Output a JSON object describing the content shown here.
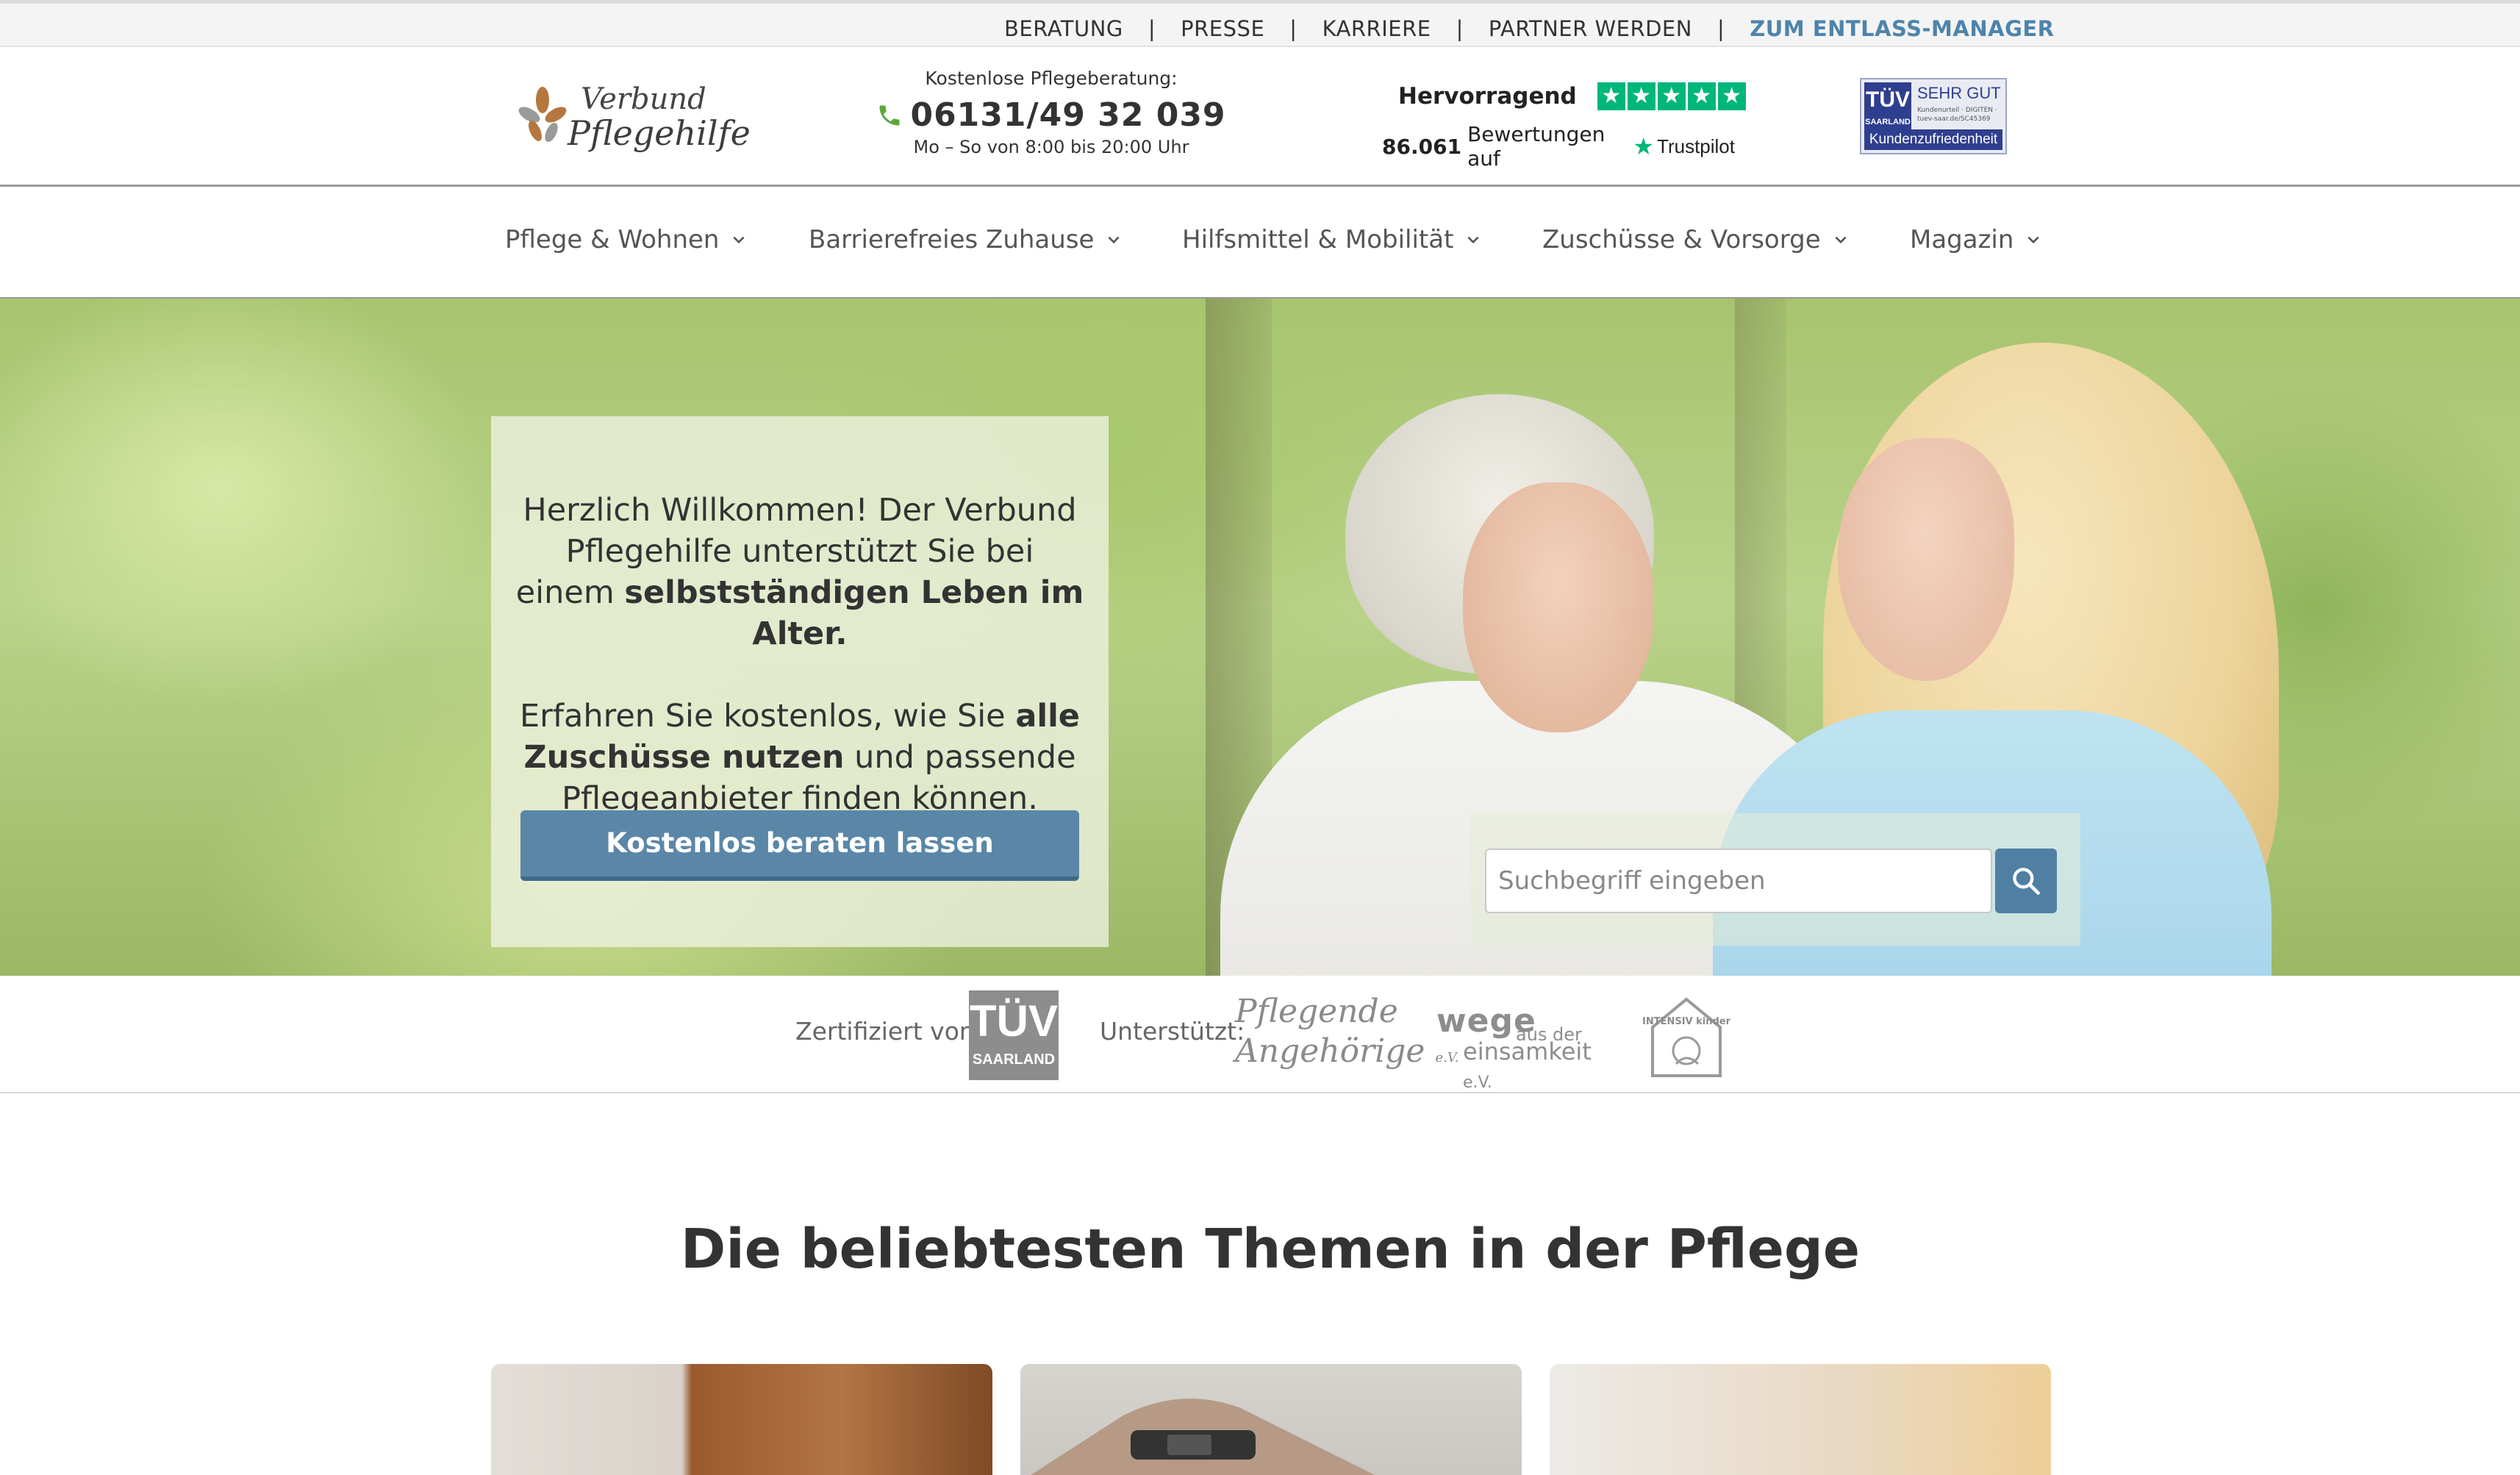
{
  "topbar": {
    "links": [
      "BERATUNG",
      "PRESSE",
      "KARRIERE",
      "PARTNER WERDEN"
    ],
    "separator": "|",
    "accent_link": "ZUM ENTLASS-MANAGER"
  },
  "header": {
    "logo": {
      "line1": "Verbund",
      "line2": "Pflegehilfe"
    },
    "phone": {
      "caption": "Kostenlose Pflegeberatung:",
      "number": "06131/49 32 039",
      "hours": "Mo – So von 8:00 bis 20:00 Uhr"
    },
    "trustpilot": {
      "rating_label": "Hervorragend",
      "stars": 5,
      "reviews_count": "86.061",
      "reviews_text": "Bewertungen auf",
      "brand": "Trustpilot"
    },
    "tuv_badge": {
      "logo_top": "TÜV",
      "logo_bottom": "SAARLAND",
      "grade": "SEHR GUT",
      "fine_print": "Kundenurteil · DIGITEN · tuev-saar.de/SC45369",
      "label": "Kundenzufriedenheit"
    }
  },
  "nav": {
    "items": [
      {
        "label": "Pflege & Wohnen"
      },
      {
        "label": "Barrierefreies Zuhause"
      },
      {
        "label": "Hilfsmittel & Mobilität"
      },
      {
        "label": "Zuschüsse & Vorsorge"
      },
      {
        "label": "Magazin"
      }
    ]
  },
  "hero": {
    "welcome": {
      "p1_a": "Herzlich Willkommen! Der Verbund Pflegehilfe unterstützt Sie bei einem ",
      "p1_b": "selbstständigen Leben im Alter.",
      "p2_a": "Erfahren Sie kostenlos, wie Sie ",
      "p2_b": "alle Zuschüsse nutzen",
      "p2_c": " und passende Pflegeanbieter finden können."
    },
    "cta_label": "Kostenlos beraten lassen",
    "search": {
      "placeholder": "Suchbegriff eingeben"
    }
  },
  "trust": {
    "certified_label": "Zertifiziert von:",
    "tuv_big": "TÜV",
    "tuv_small": "SAARLAND",
    "supported_label": "Unterstützt:",
    "partner1_line1": "Pflegende",
    "partner1_line2": "Angehörige",
    "partner1_suffix": "e.V.",
    "partner2_word": "wege",
    "partner2_small": "aus der",
    "partner2_line2": "einsamkeit",
    "partner2_suffix": "e.V.",
    "partner3_text": "INTENSIV kinder"
  },
  "themes": {
    "title": "Die beliebtesten Themen in der Pflege"
  },
  "colors": {
    "accent": "#4d84ab",
    "cta": "#5a87a8",
    "trustpilot_green": "#00b67a",
    "phone_green": "#5aa83a"
  }
}
